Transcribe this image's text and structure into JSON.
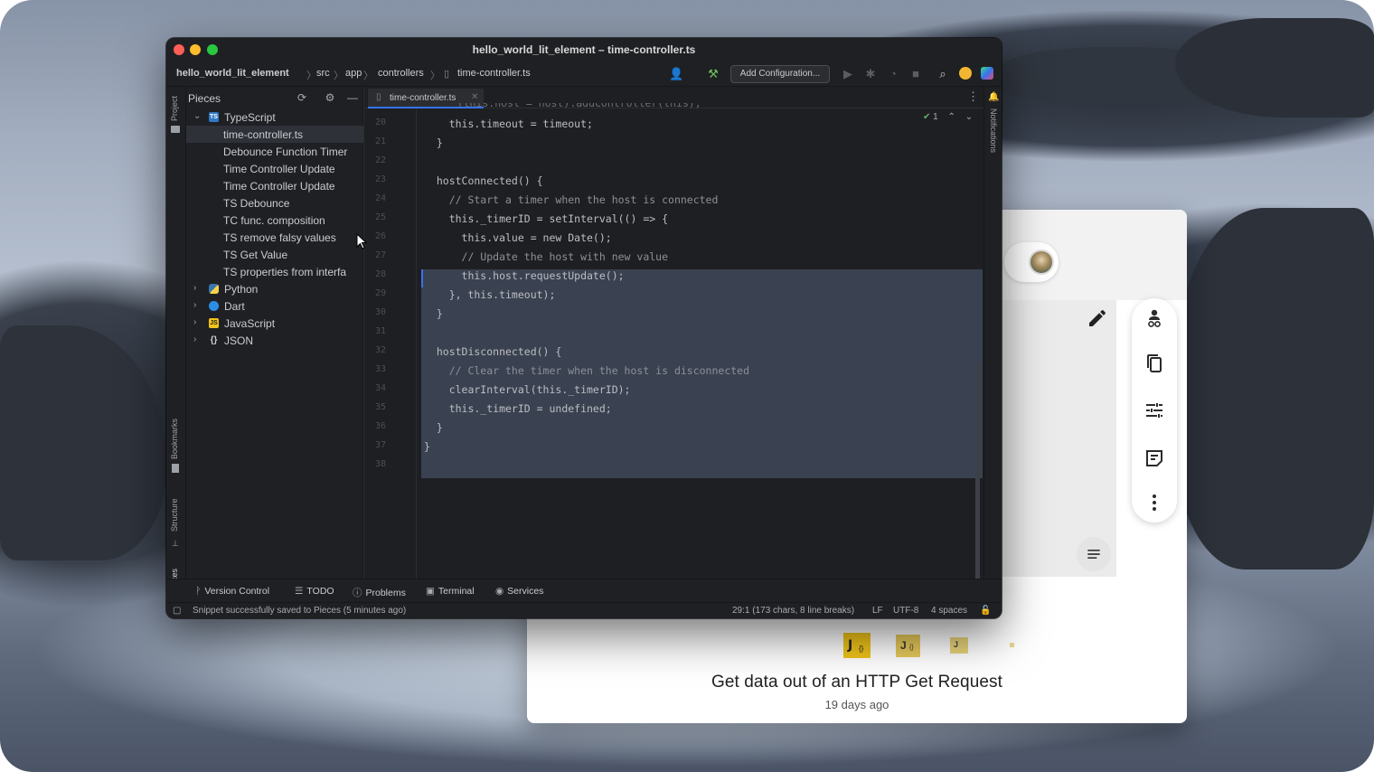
{
  "ide": {
    "window_title": "hello_world_lit_element – time-controller.ts",
    "breadcrumbs": [
      "hello_world_lit_element",
      "src",
      "app",
      "controllers",
      "time-controller.ts"
    ],
    "add_configuration": "Add Configuration...",
    "left_stripe": [
      "Project",
      "Bookmarks",
      "Structure",
      "Pieces"
    ],
    "right_stripe": [
      "Notifications"
    ],
    "project_pane": {
      "title": "Pieces",
      "tree": [
        {
          "label": "TypeScript",
          "icon": "typescript-icon",
          "expanded": true,
          "level": 0
        },
        {
          "label": "time-controller.ts",
          "level": 1,
          "selected": true
        },
        {
          "label": "Debounce Function Timer",
          "level": 1
        },
        {
          "label": "Time Controller Update",
          "level": 1
        },
        {
          "label": "Time Controller Update",
          "level": 1
        },
        {
          "label": "TS Debounce",
          "level": 1
        },
        {
          "label": "TC func. composition",
          "level": 1
        },
        {
          "label": "TS remove falsy values",
          "level": 1
        },
        {
          "label": "TS Get Value",
          "level": 1
        },
        {
          "label": "TS properties from interfa",
          "level": 1
        },
        {
          "label": "Python",
          "icon": "python-icon",
          "level": 0
        },
        {
          "label": "Dart",
          "icon": "dart-icon",
          "level": 0
        },
        {
          "label": "JavaScript",
          "icon": "javascript-icon",
          "level": 0
        },
        {
          "label": "JSON",
          "icon": "json-icon",
          "level": 0
        }
      ]
    },
    "editor": {
      "tab_label": "time-controller.ts",
      "inspection_count": "1",
      "line_numbers": [
        "20",
        "21",
        "22",
        "23",
        "24",
        "25",
        "26",
        "27",
        "28",
        "29",
        "30",
        "31",
        "32",
        "33",
        "34",
        "35",
        "36",
        "37",
        "38"
      ],
      "code_lines": [
        "    this.timeout = timeout;",
        "  }",
        "",
        "  hostConnected() {",
        "    // Start a timer when the host is connected",
        "    this._timerID = setInterval(() => {",
        "      this.value = new Date();",
        "      // Update the host with new value",
        "      this.host.requestUpdate();",
        "    }, this.timeout);",
        "  }",
        "",
        "  hostDisconnected() {",
        "    // Clear the timer when the host is disconnected",
        "    clearInterval(this._timerID);",
        "    this._timerID = undefined;",
        "  }",
        "}",
        ""
      ],
      "partial_top_line": "    (this.host = host).addController(this);"
    },
    "bottom_tools": [
      "Version Control",
      "TODO",
      "Problems",
      "Terminal",
      "Services"
    ],
    "status": {
      "message": "Snippet successfully saved to Pieces (5 minutes ago)",
      "position": "29:1 (173 chars, 8 line breaks)",
      "line_separator": "LF",
      "encoding": "UTF-8",
      "indent": "4 spaces"
    }
  },
  "pieces_app": {
    "snippet_title": "Get data out of an HTTP Get Request",
    "snippet_date": "19 days ago",
    "toolbar_icons": [
      "reference-icon",
      "copy-icon",
      "tune-icon",
      "notes-icon",
      "more-icon"
    ]
  },
  "colors": {
    "ide_bg": "#1e1f22",
    "selection": "#3a4150",
    "accent": "#3574f0",
    "traffic_red": "#ff5f57",
    "traffic_yellow": "#febc2e",
    "traffic_green": "#28c840"
  }
}
